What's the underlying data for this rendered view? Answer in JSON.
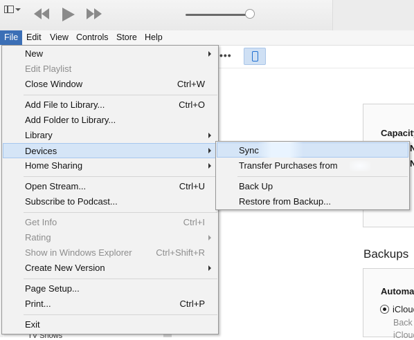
{
  "menubar": {
    "items": [
      {
        "label": "File",
        "active": true
      },
      {
        "label": "Edit"
      },
      {
        "label": "View"
      },
      {
        "label": "Controls"
      },
      {
        "label": "Store"
      },
      {
        "label": "Help"
      }
    ]
  },
  "file_menu": {
    "new": {
      "label": "New"
    },
    "edit_playlist": {
      "label": "Edit Playlist"
    },
    "close_window": {
      "label": "Close Window",
      "shortcut": "Ctrl+W"
    },
    "add_file": {
      "label": "Add File to Library...",
      "shortcut": "Ctrl+O"
    },
    "add_folder": {
      "label": "Add Folder to Library..."
    },
    "library": {
      "label": "Library"
    },
    "devices": {
      "label": "Devices"
    },
    "home_sharing": {
      "label": "Home Sharing"
    },
    "open_stream": {
      "label": "Open Stream...",
      "shortcut": "Ctrl+U"
    },
    "subscribe_podcast": {
      "label": "Subscribe to Podcast..."
    },
    "get_info": {
      "label": "Get Info",
      "shortcut": "Ctrl+I"
    },
    "rating": {
      "label": "Rating"
    },
    "show_explorer": {
      "label": "Show in Windows Explorer",
      "shortcut": "Ctrl+Shift+R"
    },
    "create_version": {
      "label": "Create New Version"
    },
    "page_setup": {
      "label": "Page Setup..."
    },
    "print": {
      "label": "Print...",
      "shortcut": "Ctrl+P"
    },
    "exit": {
      "label": "Exit"
    }
  },
  "devices_menu": {
    "sync": {
      "label": "Sync"
    },
    "transfer": {
      "label": "Transfer Purchases from"
    },
    "back_up": {
      "label": "Back Up"
    },
    "restore": {
      "label": "Restore from Backup..."
    }
  },
  "content": {
    "capacity": "Capacity",
    "cap_n1": "N",
    "cap_n2": "N",
    "backups": "Backups",
    "automa": "Automa",
    "icloud": "iCloud",
    "back": "Back",
    "icloud2": "iCloud",
    "tv_shows": "TV Shows"
  },
  "colors": {
    "menu_active": "#3b6fb6",
    "hover_bg": "#d5e5f7",
    "device_accent": "#1f6fd1"
  },
  "icons": [
    "window-menu-icon",
    "previous-icon",
    "play-icon",
    "next-icon",
    "more-icon",
    "iphone-icon"
  ]
}
